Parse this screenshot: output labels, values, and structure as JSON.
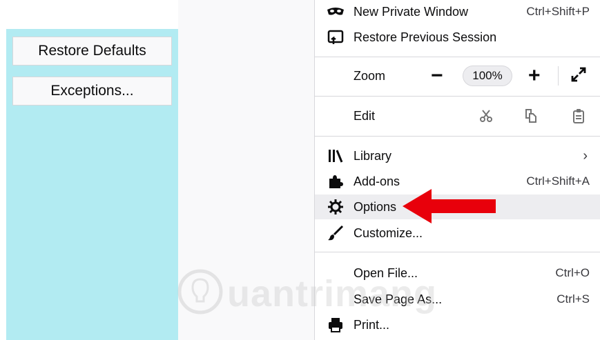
{
  "left_panel": {
    "restore_defaults_label": "Restore Defaults",
    "exceptions_label": "Exceptions..."
  },
  "menu": {
    "new_private_window": {
      "label": "New Private Window",
      "shortcut": "Ctrl+Shift+P",
      "icon": "mask-icon"
    },
    "restore_session": {
      "label": "Restore Previous Session",
      "icon": "restore-icon"
    },
    "zoom": {
      "label": "Zoom",
      "minus": "−",
      "value": "100%",
      "plus": "+"
    },
    "edit": {
      "label": "Edit"
    },
    "library": {
      "label": "Library",
      "chevron": "›",
      "icon": "library-icon"
    },
    "addons": {
      "label": "Add-ons",
      "shortcut": "Ctrl+Shift+A",
      "icon": "puzzle-icon"
    },
    "options": {
      "label": "Options",
      "icon": "gear-icon"
    },
    "customize": {
      "label": "Customize...",
      "icon": "brush-icon"
    },
    "open_file": {
      "label": "Open File...",
      "shortcut": "Ctrl+O"
    },
    "save_page": {
      "label": "Save Page As...",
      "shortcut": "Ctrl+S"
    },
    "print": {
      "label": "Print...",
      "icon": "printer-icon"
    }
  },
  "colors": {
    "panel_cyan": "#b2ebf2",
    "arrow_red": "#e8000b",
    "highlight": "#ededf0"
  },
  "watermark": {
    "text": "uantrimang"
  }
}
